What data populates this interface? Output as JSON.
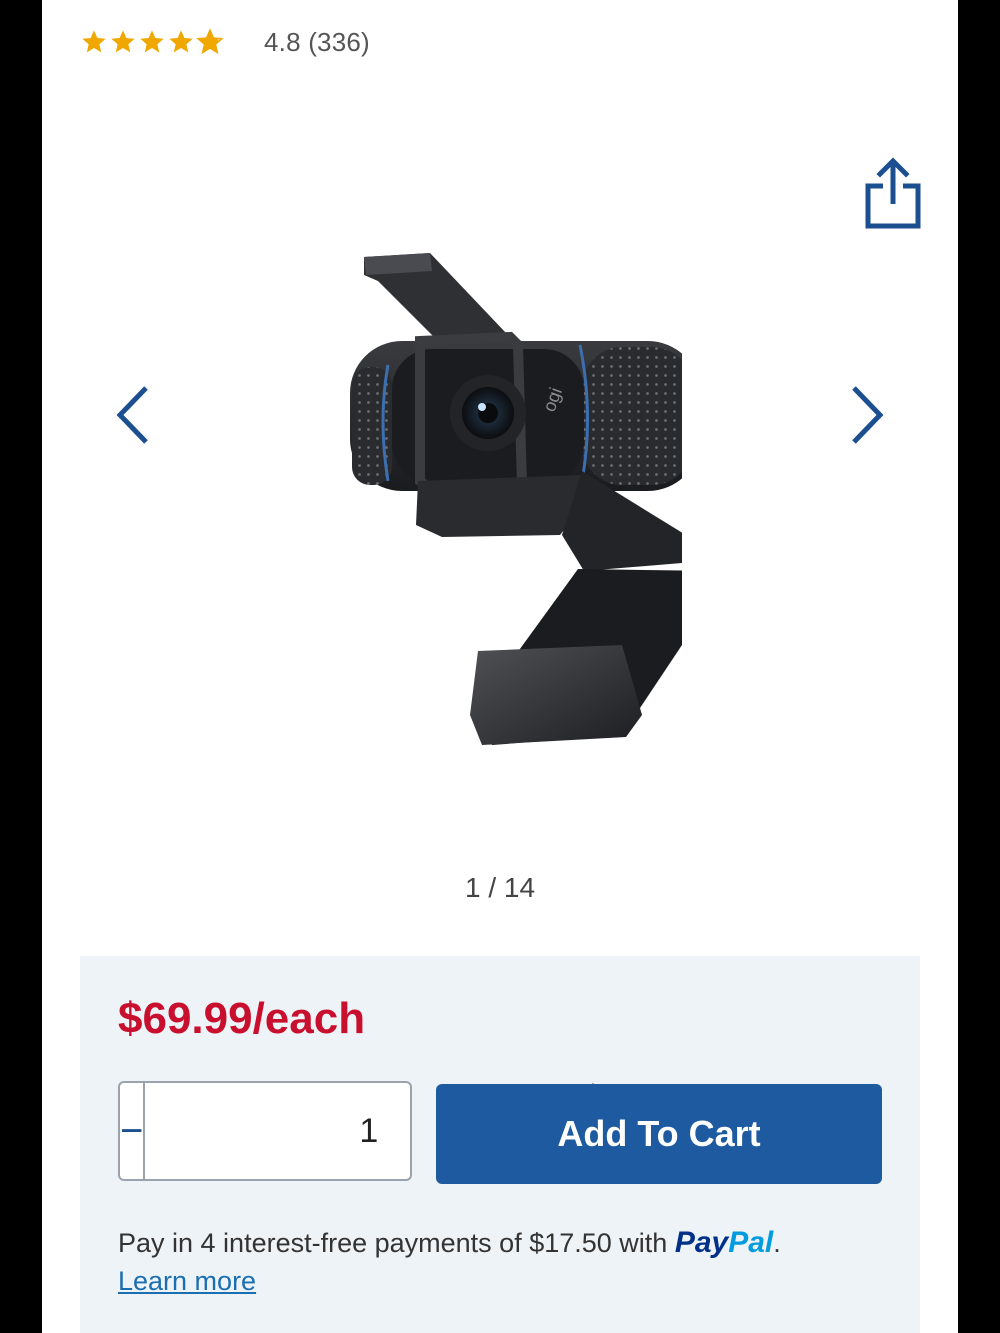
{
  "rating": {
    "value": "4.8",
    "count": "(336)",
    "stars": 4.8,
    "star_color": "#f0a800"
  },
  "gallery": {
    "counter": "1 / 14",
    "share_icon": "share-icon",
    "prev_icon": "chevron-left-icon",
    "next_icon": "chevron-right-icon",
    "image": "webcam-product-image"
  },
  "purchase": {
    "price": "$69.99/each",
    "price_color": "#c8102e",
    "quantity": "1",
    "minus_label": "−",
    "plus_label": "+",
    "add_to_cart_label": "Add To Cart",
    "button_color": "#1e5aa0",
    "paypal_text": "Pay in 4 interest-free payments of $17.50 with",
    "paypal_logo_pay": "Pay",
    "paypal_logo_pal": "Pal",
    "paypal_period": ".",
    "learn_more": "Learn more"
  }
}
